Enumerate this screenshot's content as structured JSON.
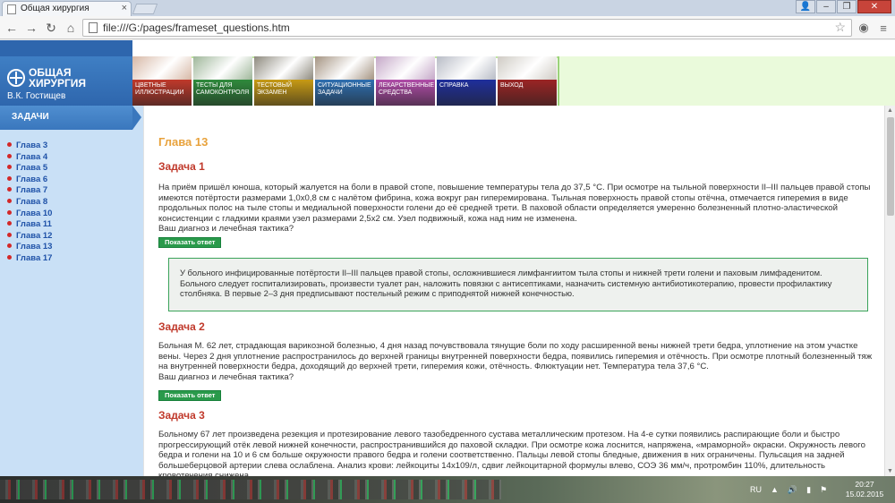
{
  "browser": {
    "tab_title": "Общая хирургия",
    "url": "file:///G:/pages/frameset_questions.htm"
  },
  "header": {
    "logo_title": "ОБЩАЯ ХИРУРГИЯ",
    "author": "В.К. Гостищев",
    "nav": [
      {
        "label": "Цветные иллюстрации",
        "color": "#c0392b",
        "img": "#d7b8a6"
      },
      {
        "label": "Тесты для самоконтроля",
        "color": "#2f8a3c",
        "img": "#9fb79a"
      },
      {
        "label": "Тестовый экзамен",
        "color": "#c79a14",
        "img": "#8e8a7e"
      },
      {
        "label": "Ситуационные задачи",
        "color": "#2e6fb0",
        "img": "#a59482"
      },
      {
        "label": "Лекарственные средства",
        "color": "#b04ca8",
        "img": "#c5a8c8"
      },
      {
        "label": "Справка",
        "color": "#1f2f9c",
        "img": "#b8bcc6"
      },
      {
        "label": "Выход",
        "color": "#9b2424",
        "img": "#cfcbc4"
      }
    ]
  },
  "sidebar": {
    "header": "ЗАДАЧИ",
    "chapters": [
      "Глава 3",
      "Глава 4",
      "Глава 5",
      "Глава 6",
      "Глава 7",
      "Глава 8",
      "Глава 10",
      "Глава 11",
      "Глава 12",
      "Глава 13",
      "Глава 17"
    ]
  },
  "content": {
    "chapter_title": "Глава 13",
    "show_answer_label": "Показать ответ",
    "task1": {
      "title": "Задача 1",
      "text": "На приём пришёл юноша, который жалуется на боли в правой стопе, повышение температуры тела до 37,5 °C. При осмотре на тыльной поверхности II–III пальцев правой стопы имеются потёртости размерами 1,0х0,8 см с налётом фибрина, кожа вокруг ран гиперемирована. Тыльная поверхность правой стопы отёчна, отмечается гиперемия в виде продольных полос на тыле стопы и медиальной поверхности голени до её средней трети. В паховой области определяется умеренно болезненный плотно-эластической консистенции с гладкими краями узел размерами 2,5х2 см. Узел подвижный, кожа над ним не изменена.",
      "question": "Ваш диагноз и лечебная тактика?",
      "answer": "У больного инфицированные потёртости II–III пальцев правой стопы, осложнившиеся лимфангиитом тыла стопы и нижней трети голени и паховым лимфаденитом. Больного следует госпитализировать, произвести туалет ран, наложить повязки с антисептиками, назначить системную антибиотикотерапию, провести профилактику столбняка. В первые 2–3 дня предписывают постельный режим с приподнятой нижней конечностью."
    },
    "task2": {
      "title": "Задача 2",
      "text": "Больная М. 62 лет, страдающая варикозной болезнью, 4 дня назад почувствовала тянущие боли по ходу расширенной вены нижней трети бедра, уплотнение на этом участке вены. Через 2 дня уплотнение распространилось до верхней границы внутренней поверхности бедра, появились гиперемия и отёчность. При осмотре плотный болезненный тяж на внутренней поверхности бедра, доходящий до верхней трети, гиперемия кожи, отёчность. Флюктуации нет. Температура тела 37,6 °C.",
      "question": "Ваш диагноз и лечебная тактика?"
    },
    "task3": {
      "title": "Задача 3",
      "text": "Больному 67 лет произведена резекция и протезирование левого тазобедренного сустава металлическим протезом. На 4-е сутки появились распирающие боли и быстро прогрессирующий отёк левой нижней конечности, распространившийся до паховой складки. При осмотре кожа лоснится, напряжена, «мраморной» окраски. Окружность левого бедра и голени на 10 и 6 см больше окружности правого бедра и голени соответственно. Пальцы левой стопы бледные, движения в них ограничены. Пульсация на задней большеберцовой артерии слева ослаблена. Анализ крови: лейкоциты 14х109/л, сдвиг лейкоцитарной формулы влево, СОЭ 36 мм/ч, протромбин 110%, длительность кровотечения снижена."
    }
  },
  "taskbar": {
    "lang": "RU",
    "time": "20:27",
    "date": "15.02.2015"
  }
}
